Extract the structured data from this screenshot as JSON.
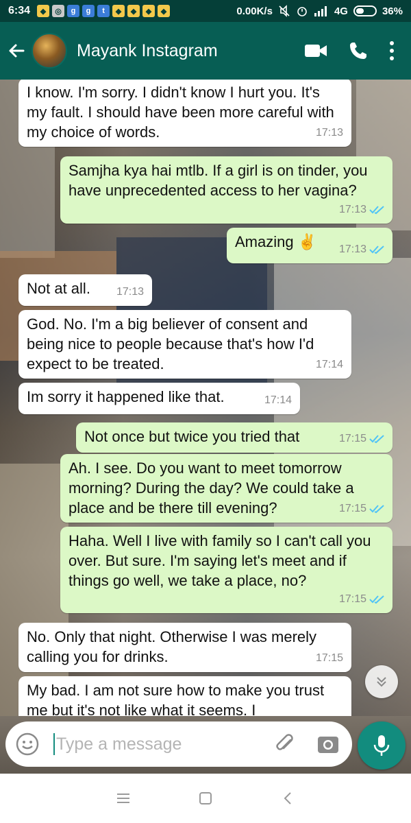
{
  "status_bar": {
    "time": "6:34",
    "network_speed": "0.00K/s",
    "network_type": "4G",
    "battery": "36%",
    "notification_icons": [
      "snapchat-icon",
      "instagram-icon",
      "google-plus-icon",
      "google-plus-icon",
      "twitter-icon",
      "snapchat-icon",
      "snapchat-icon",
      "snapchat-icon",
      "snapchat-icon"
    ]
  },
  "header": {
    "contact_name": "Mayank Instagram",
    "accent": "#075e54"
  },
  "messages": [
    {
      "side": "in",
      "lines": "I know. I'm sorry. I didn't know I hurt you. It's my fault. I should have been more careful with my choice of words.",
      "time": "17:13"
    },
    {
      "side": "out",
      "lines": "Samjha kya hai mtlb. If a girl is on tinder, you have unprecedented access to her vagina?",
      "time": "17:13"
    },
    {
      "side": "out",
      "lines": "Amazing",
      "emoji": "✌",
      "time": "17:13"
    },
    {
      "side": "in",
      "lines": "Not at all.",
      "time": "17:13"
    },
    {
      "side": "in",
      "lines": "God. No. I'm a big believer of consent and being nice to people because that's how I'd expect to be treated.",
      "time": "17:14"
    },
    {
      "side": "in",
      "lines": "Im sorry it happened like that.",
      "time": "17:14"
    },
    {
      "side": "out",
      "lines": "Not once but twice you tried that",
      "time": "17:15"
    },
    {
      "side": "out",
      "lines": "Ah. I see. Do you want to meet tomorrow morning? During the day? We could take a place and be there till evening?",
      "time": "17:15"
    },
    {
      "side": "out",
      "lines": "Haha. Well I live with family so I can't call you over. But sure. I'm saying let's meet and if things go well, we take a place, no?",
      "time": "17:15"
    },
    {
      "side": "in",
      "lines": "No. Only that night. Otherwise I was merely calling you for drinks.",
      "time": "17:15"
    },
    {
      "side": "in",
      "lines": "My bad. I am not sure how to make you trust me but it's not like what it seems. I",
      "time": ""
    }
  ],
  "input": {
    "placeholder": "Type a message"
  },
  "colors": {
    "incoming_bubble": "#ffffff",
    "outgoing_bubble": "#dcf8c6",
    "read_tick": "#4fc3f7",
    "fab": "#128c7e"
  }
}
